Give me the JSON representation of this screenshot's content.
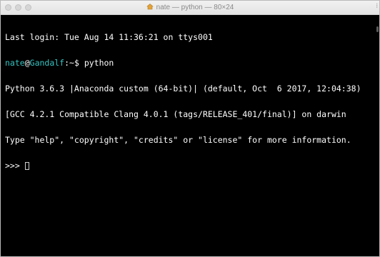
{
  "window": {
    "title": "nate — python — 80×24"
  },
  "terminal": {
    "last_login": "Last login: Tue Aug 14 11:36:21 on ttys001",
    "prompt": {
      "user": "nate",
      "at": "@",
      "host": "Gandalf",
      "path": ":~$",
      "command": " python"
    },
    "output": [
      "Python 3.6.3 |Anaconda custom (64-bit)| (default, Oct  6 2017, 12:04:38)",
      "[GCC 4.2.1 Compatible Clang 4.0.1 (tags/RELEASE_401/final)] on darwin",
      "Type \"help\", \"copyright\", \"credits\" or \"license\" for more information."
    ],
    "repl_prompt": ">>> "
  },
  "colors": {
    "background": "#000000",
    "text": "#ffffff",
    "prompt_accent": "#34c3c1"
  },
  "icons": {
    "title_icon": "house-icon"
  }
}
